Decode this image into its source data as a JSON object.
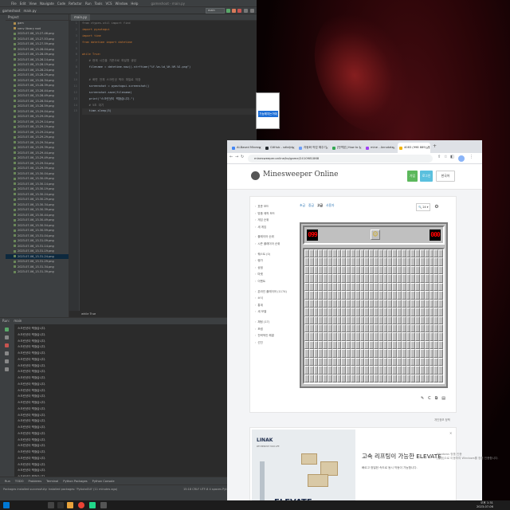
{
  "ide": {
    "menu": [
      "File",
      "Edit",
      "View",
      "Navigate",
      "Code",
      "Refactor",
      "Run",
      "Tools",
      "VCS",
      "Window",
      "Help"
    ],
    "window_title": "gameshoot - main.py",
    "nav": [
      "gameshoot",
      "main.py"
    ],
    "run_config": "main",
    "project_label": "Project",
    "tree": [
      {
        "label": "gam",
        "dir": true
      },
      {
        "label": "venv  library root",
        "dir": true
      },
      {
        "label": "2023-07-06_13-27-46.png"
      },
      {
        "label": "2023-07-06_13-27-53.png"
      },
      {
        "label": "2023-07-06_13-27-59.png"
      },
      {
        "label": "2023-07-06_13-28-04.png"
      },
      {
        "label": "2023-07-06_13-28-09.png"
      },
      {
        "label": "2023-07-06_13-28-14.png"
      },
      {
        "label": "2023-07-06_13-28-19.png"
      },
      {
        "label": "2023-07-06_13-28-24.png"
      },
      {
        "label": "2023-07-06_13-28-29.png"
      },
      {
        "label": "2023-07-06_13-28-34.png"
      },
      {
        "label": "2023-07-06_13-28-39.png"
      },
      {
        "label": "2023-07-06_13-28-44.png"
      },
      {
        "label": "2023-07-06_13-28-49.png"
      },
      {
        "label": "2023-07-06_13-28-54.png"
      },
      {
        "label": "2023-07-06_13-28-59.png"
      },
      {
        "label": "2023-07-06_13-29-04.png"
      },
      {
        "label": "2023-07-06_13-29-09.png"
      },
      {
        "label": "2023-07-06_13-29-14.png"
      },
      {
        "label": "2023-07-06_13-29-19.png"
      },
      {
        "label": "2023-07-06_13-29-24.png"
      },
      {
        "label": "2023-07-06_13-29-29.png"
      },
      {
        "label": "2023-07-06_13-29-34.png"
      },
      {
        "label": "2023-07-06_13-29-39.png"
      },
      {
        "label": "2023-07-06_13-29-44.png"
      },
      {
        "label": "2023-07-06_13-29-49.png"
      },
      {
        "label": "2023-07-06_13-29-54.png"
      },
      {
        "label": "2023-07-06_13-29-59.png"
      },
      {
        "label": "2023-07-06_13-30-04.png"
      },
      {
        "label": "2023-07-06_13-30-09.png"
      },
      {
        "label": "2023-07-06_13-30-14.png"
      },
      {
        "label": "2023-07-06_13-30-19.png"
      },
      {
        "label": "2023-07-06_13-30-24.png"
      },
      {
        "label": "2023-07-06_13-30-29.png"
      },
      {
        "label": "2023-07-06_13-30-34.png"
      },
      {
        "label": "2023-07-06_13-30-39.png"
      },
      {
        "label": "2023-07-06_13-30-44.png"
      },
      {
        "label": "2023-07-06_13-30-49.png"
      },
      {
        "label": "2023-07-06_13-30-54.png"
      },
      {
        "label": "2023-07-06_13-30-59.png"
      },
      {
        "label": "2023-07-06_13-31-04.png"
      },
      {
        "label": "2023-07-06_13-31-09.png"
      },
      {
        "label": "2023-07-06_13-31-14.png"
      },
      {
        "label": "2023-07-06_13-31-19.png"
      },
      {
        "label": "2023-07-06_13-31-24.png",
        "selected": true
      },
      {
        "label": "2023-07-06_13-31-29.png"
      },
      {
        "label": "2023-07-06_13-31-34.png"
      },
      {
        "label": "2023-07-06_13-31-39.png"
      }
    ],
    "editor_tab": "main.py",
    "code": [
      {
        "t": "from ctypes.util import find",
        "c": "cm"
      },
      {
        "t": "import pyautogui",
        "c": "kw"
      },
      {
        "t": "import time",
        "c": "kw"
      },
      {
        "t": "from datetime import datetime",
        "c": "kw"
      },
      {
        "t": "",
        "c": ""
      },
      {
        "t": "while True:",
        "c": "kw"
      },
      {
        "t": "    # 현재 시간을 기준으로 파일명 생성",
        "c": "cm"
      },
      {
        "t": "    filename = datetime.now().strftime(\"%Y-%m-%d_%H-%M-%S.png\")",
        "c": ""
      },
      {
        "t": "",
        "c": ""
      },
      {
        "t": "    # 화면 전체 스크린샷 찍어 파일로 저장",
        "c": "cm"
      },
      {
        "t": "    screenshot = pyautogui.screenshot()",
        "c": ""
      },
      {
        "t": "    screenshot.save(filename)",
        "c": ""
      },
      {
        "t": "    print(\"스크린샷이 찍혔습니다.\")",
        "c": ""
      },
      {
        "t": "    # 5초 대기",
        "c": "cm"
      },
      {
        "t": "    time.sleep(5)",
        "c": "cur"
      }
    ],
    "editor_status": "while True",
    "run_label": "Run:",
    "run_tab": "main",
    "run_output": "스크린샷이 찍혔습니다.",
    "run_output_count": 25,
    "bottom_tabs": [
      "Run",
      "TODO",
      "Problems",
      "Terminal",
      "Python Packages",
      "Python Console"
    ],
    "status_message": "Packages installed successfully: Installed packages: 'PyAutoGUI' (11 minutes ago)",
    "status_right": "15:18  CRLF  UTF-8  4 spaces  Python 3.9"
  },
  "small_window": {
    "button": "가능해지는거에"
  },
  "chrome": {
    "tabs": [
      {
        "label": "AI-Based Minesw",
        "color": "#4285f4"
      },
      {
        "label": "GitHub - sdkdjdc",
        "color": "#24292e"
      },
      {
        "label": "자동화 작업 해주기",
        "color": "#6c9ef8"
      },
      {
        "label": "[번역본] How to f",
        "color": "#34a853"
      },
      {
        "label": "mine - Annotate",
        "color": "#a142f4"
      },
      {
        "label": "4083 (998 889) 게",
        "color": "#f4b400",
        "active": true
      }
    ],
    "url": "minesweeper.online/ko/game/2410981868"
  },
  "site": {
    "logo": "Minesweeper Online",
    "join": "가입",
    "login": "로그인",
    "lang": "한국어",
    "menu_groups": [
      [
        "표준 모드",
        "맞춤 제작 모드",
        "게임 순위",
        "새 게임"
      ],
      [
        "플레이어 순위",
        "시즌 플레이어 순위"
      ],
      [
        "퀘스트 (0)",
        "랭가",
        "상점",
        "마켓",
        "이벤트"
      ],
      [
        "온라인 플레이어 (1174)",
        "소식",
        "통계",
        "새 모델"
      ],
      [
        "채팅 (17)",
        "포럼",
        "전략적인 해결",
        "선진"
      ]
    ],
    "levels": [
      "초급",
      "중급",
      "고급",
      "사용자"
    ],
    "current_level": "고급",
    "zoom": "24",
    "mine_counter": "099",
    "timer": "000",
    "face": "☺",
    "grid_cols": 30,
    "grid_rows": 16,
    "game_tools": [
      "✎",
      "C",
      "⧉",
      "▤"
    ],
    "privacy": "개인정보 정책"
  },
  "ad": {
    "brand": "LINAK",
    "tagline": "WE IMPROVE YOUR LIFE",
    "big": "ELEVATE",
    "title": "고속 리프팅이 가능한 ELEVATE",
    "desc": "빠르고 정밀한 속도로 동시 작동이 가능합니다."
  },
  "taskbar": {
    "time": "오후 1:31",
    "date": "2023-07-06"
  },
  "overlay": {
    "lines": [
      "Windows 정품 인증",
      "[설정]으로 이동하여 Windows를 정품 인증합니다."
    ]
  }
}
